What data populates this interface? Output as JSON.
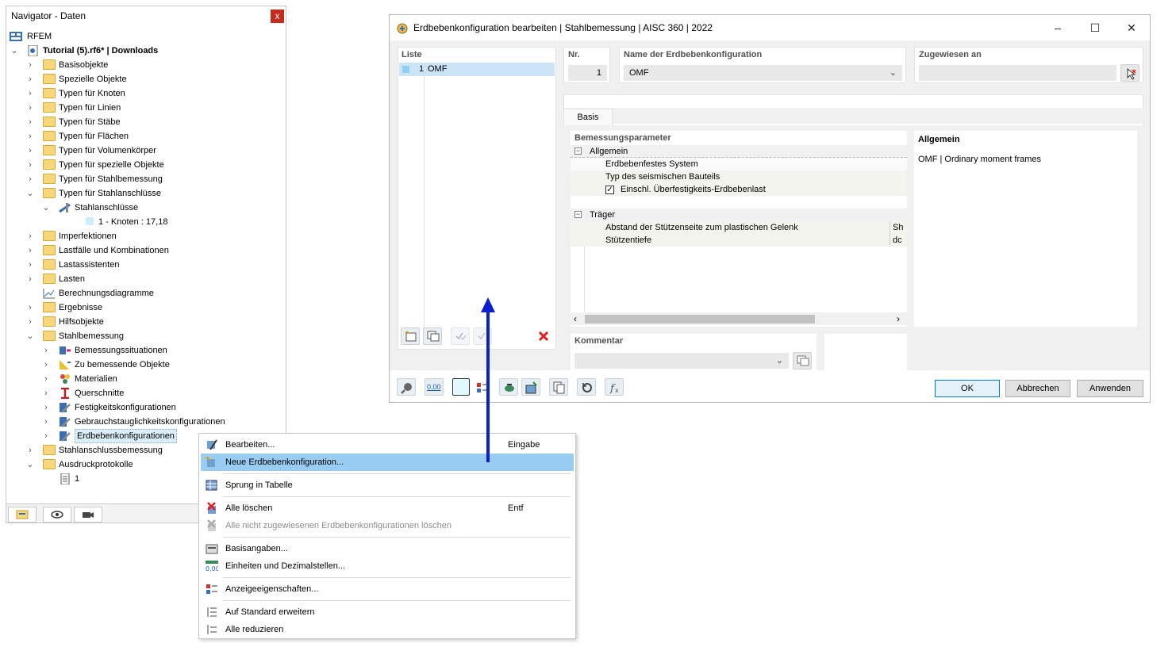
{
  "navigator": {
    "title": "Navigator - Daten",
    "close": "x",
    "items": [
      {
        "label": "RFEM",
        "bold": false
      },
      {
        "label": "Tutorial (5).rf6* | Downloads",
        "bold": true
      },
      {
        "label": "Basisobjekte"
      },
      {
        "label": "Spezielle Objekte"
      },
      {
        "label": "Typen für Knoten"
      },
      {
        "label": "Typen für Linien"
      },
      {
        "label": "Typen für Stäbe"
      },
      {
        "label": "Typen für Flächen"
      },
      {
        "label": "Typen für Volumenkörper"
      },
      {
        "label": "Typen für spezielle Objekte"
      },
      {
        "label": "Typen für Stahlbemessung"
      },
      {
        "label": "Typen für Stahlanschlüsse"
      },
      {
        "label": "Stahlanschlüsse"
      },
      {
        "label": "1 - Knoten : 17,18"
      },
      {
        "label": "Imperfektionen"
      },
      {
        "label": "Lastfälle und Kombinationen"
      },
      {
        "label": "Lastassistenten"
      },
      {
        "label": "Lasten"
      },
      {
        "label": "Berechnungsdiagramme"
      },
      {
        "label": "Ergebnisse"
      },
      {
        "label": "Hilfsobjekte"
      },
      {
        "label": "Stahlbemessung"
      },
      {
        "label": "Bemessungssituationen"
      },
      {
        "label": "Zu bemessende Objekte"
      },
      {
        "label": "Materialien"
      },
      {
        "label": "Querschnitte"
      },
      {
        "label": "Festigkeitskonfigurationen"
      },
      {
        "label": "Gebrauchstauglichkeitskonfigurationen"
      },
      {
        "label": "Erdbebenkonfigurationen"
      },
      {
        "label": "Stahlanschlussbemessung"
      },
      {
        "label": "Ausdruckprotokolle"
      },
      {
        "label": "1"
      }
    ]
  },
  "dialog": {
    "title": "Erdbebenkonfiguration bearbeiten | Stahlbemessung | AISC 360 | 2022",
    "list_header": "Liste",
    "list_items": [
      {
        "no": "1",
        "name": "OMF"
      }
    ],
    "nr_header": "Nr.",
    "nr_value": "1",
    "name_header": "Name der Erdbebenkonfiguration",
    "name_value": "OMF",
    "assigned_header": "Zugewiesen an",
    "assigned_value": "",
    "tab_basis": "Basis",
    "params_header": "Bemessungsparameter",
    "params": {
      "group1": "Allgemein",
      "g1_rows": [
        "Erdbebenfestes System",
        "Typ des seismischen Bauteils",
        "Einschl. Überfestigkeits-Erdbebenlast"
      ],
      "group2": "Träger",
      "g2_rows": [
        "Abstand der Stützenseite zum plastischen Gelenk",
        "Stützentiefe"
      ],
      "g2_symbols": [
        "Sh",
        "dc"
      ]
    },
    "info_header": "Allgemein",
    "info_text": "OMF | Ordinary moment frames",
    "comment_header": "Kommentar",
    "comment_value": "",
    "units_icon_text": "0,00",
    "ok": "OK",
    "cancel": "Abbrechen",
    "apply": "Anwenden"
  },
  "context_menu": {
    "items": [
      {
        "label": "Bearbeiten...",
        "shortcut": "Eingabe"
      },
      {
        "label": "Neue Erdbebenkonfiguration...",
        "shortcut": ""
      },
      {
        "label": "Sprung in Tabelle",
        "shortcut": ""
      },
      {
        "label": "Alle löschen",
        "shortcut": "Entf"
      },
      {
        "label": "Alle nicht zugewiesenen Erdbebenkonfigurationen löschen",
        "shortcut": ""
      },
      {
        "label": "Basisangaben...",
        "shortcut": ""
      },
      {
        "label": "Einheiten und Dezimalstellen...",
        "shortcut": ""
      },
      {
        "label": "Anzeigeeigenschaften...",
        "shortcut": ""
      },
      {
        "label": "Auf Standard erweitern",
        "shortcut": ""
      },
      {
        "label": "Alle reduzieren",
        "shortcut": ""
      }
    ]
  },
  "colors": {
    "highlight": "#99ccf3",
    "arrow": "#0a1fcf",
    "folder": "#f6d77b",
    "close_red": "#c42b1c"
  }
}
